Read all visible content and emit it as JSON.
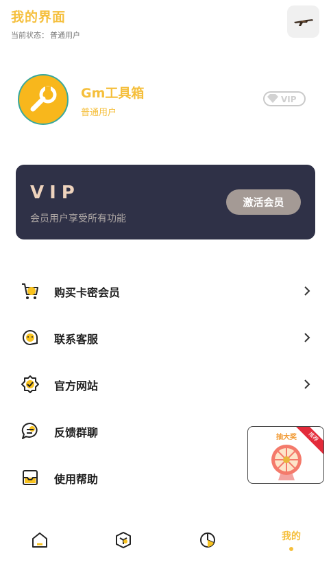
{
  "header": {
    "title": "我的界面",
    "status_label": "当前状态：",
    "status_value": "普通用户"
  },
  "profile": {
    "app_name": "Gm工具箱",
    "user_type": "普通用户",
    "badge_text": "VIP"
  },
  "vip_card": {
    "title": "VIP",
    "description": "会员用户享受所有功能",
    "button_label": "激活会员"
  },
  "menu": {
    "items": [
      {
        "label": "购买卡密会员",
        "icon": "shopping-cart-icon"
      },
      {
        "label": "联系客服",
        "icon": "customer-service-icon"
      },
      {
        "label": "官方网站",
        "icon": "official-site-icon"
      },
      {
        "label": "反馈群聊",
        "icon": "chat-bubble-icon"
      },
      {
        "label": "使用帮助",
        "icon": "help-inbox-icon"
      }
    ]
  },
  "promo": {
    "title": "抽大奖",
    "ribbon": "推荐"
  },
  "tabbar": {
    "items": [
      {
        "icon": "home-icon"
      },
      {
        "icon": "cube-icon"
      },
      {
        "icon": "pie-chart-icon"
      },
      {
        "label": "我的"
      }
    ]
  },
  "colors": {
    "accent": "#f5bf3c",
    "card_bg": "#2f3147",
    "vip_gold": "#eed3bd",
    "activate_button": "#a49a95"
  }
}
